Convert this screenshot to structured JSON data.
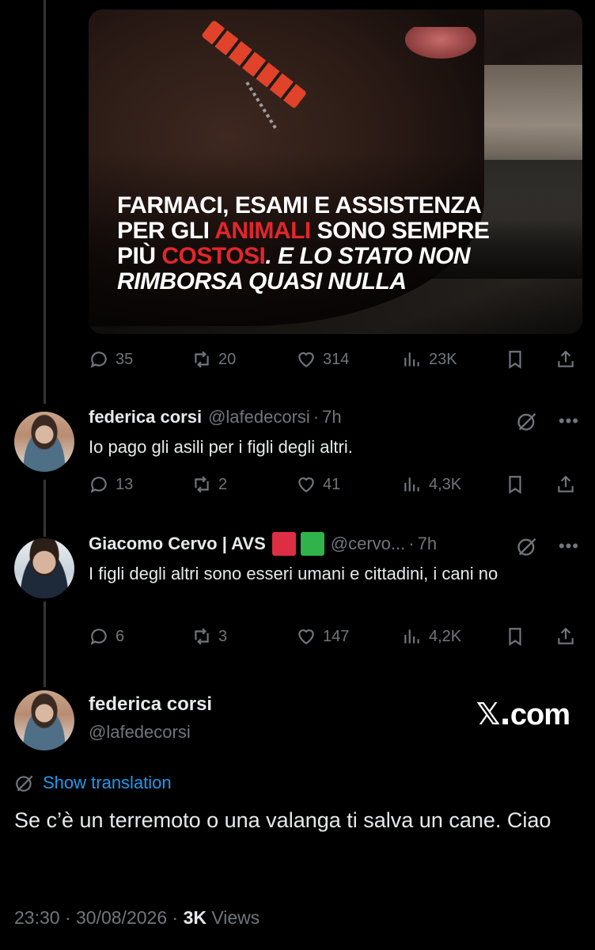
{
  "post": {
    "media": {
      "headline_line1": "FARMACI, ESAMI E ASSISTENZA",
      "headline_line2_pre": "PER GLI ",
      "headline_line2_red": "ANIMALI",
      "headline_line2_post": " SONO SEMPRE",
      "headline_line3_pre": "PIÙ ",
      "headline_line3_red": "COSTOSI",
      "headline_line3_post": ". E LO STATO NON",
      "headline_line4": "RIMBORSA QUASI NULLA"
    },
    "actions": {
      "replies": "35",
      "reposts": "20",
      "likes": "314",
      "views": "23K"
    }
  },
  "reply1": {
    "name": "federica corsi",
    "handle": "@lafedecorsi",
    "time": "7h",
    "text": "Io pago gli asili per i figli degli altri.",
    "actions": {
      "replies": "13",
      "reposts": "2",
      "likes": "41",
      "views": "4,3K"
    }
  },
  "reply2": {
    "name": "Giacomo Cervo | AVS",
    "handle": "@cervo...",
    "time": "7h",
    "text": "I figli degli altri sono esseri umani e cittadini, i cani no",
    "actions": {
      "replies": "6",
      "reposts": "3",
      "likes": "147",
      "views": "4,2K"
    }
  },
  "main": {
    "name": "federica corsi",
    "handle": "@lafedecorsi",
    "site": "com",
    "site_x": "𝕏.",
    "show_translation": "Show translation",
    "text": "Se c’è un terremoto o una valanga ti salva un cane. Ciao",
    "time": "23:30 · 30/08/2026 · ",
    "views_count": "3K",
    "views_label": " Views"
  },
  "colors": {
    "accent": "#1d9bf0",
    "muted": "#71767b",
    "headline_red": "#e3262b"
  }
}
